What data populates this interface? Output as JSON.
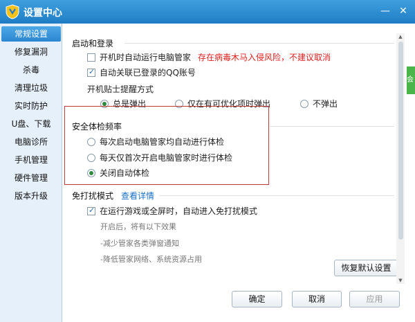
{
  "window": {
    "title": "设置中心",
    "minimize_label": "—",
    "close_label": "✕"
  },
  "sidebar": {
    "items": [
      {
        "label": "常规设置",
        "active": true
      },
      {
        "label": "修复漏洞"
      },
      {
        "label": "杀毒"
      },
      {
        "label": "清理垃圾"
      },
      {
        "label": "实时防护"
      },
      {
        "label": "U盘、下载"
      },
      {
        "label": "电脑诊所"
      },
      {
        "label": "手机管理"
      },
      {
        "label": "硬件管理"
      },
      {
        "label": "版本升级"
      }
    ]
  },
  "startup": {
    "section_title": "启动和登录",
    "autostart_label": "开机时自动运行电脑管家",
    "autostart_checked": false,
    "autostart_warning": "存在病毒木马入侵风险，不建议取消",
    "qq_label": "自动关联已登录的QQ账号",
    "qq_checked": true,
    "tips_label": "开机贴士提醒方式",
    "tips_options": [
      {
        "label": "总是弹出",
        "selected": true
      },
      {
        "label": "仅在有可优化项时弹出",
        "selected": false
      },
      {
        "label": "不弹出",
        "selected": false
      }
    ]
  },
  "checkup": {
    "section_title": "安全体检频率",
    "options": [
      {
        "label": "每次启动电脑管家均自动进行体检",
        "selected": false
      },
      {
        "label": "每天仅首次开启电脑管家时进行体检",
        "selected": false
      },
      {
        "label": "关闭自动体检",
        "selected": true
      }
    ]
  },
  "dnd": {
    "section_title": "免打扰模式",
    "details_link": "查看详情",
    "auto_label": "在运行游戏或全屏时，自动进入免打扰模式",
    "auto_checked": true,
    "effect_intro": "开启后，将有以下效果",
    "effect_1": "-减少管家各类弹窗通知",
    "effect_2": "-降低管家网络、系统资源占用"
  },
  "buttons": {
    "restore_default": "恢复默认设置",
    "ok": "确定",
    "cancel": "取消",
    "apply": "应用"
  },
  "side_tab": {
    "label": "会"
  },
  "colors": {
    "titlebar": "#1f7cc4",
    "active_nav": "#2a86d1",
    "warning": "#e02020",
    "link": "#1a6fc4",
    "highlight_box": "#c0393b"
  }
}
